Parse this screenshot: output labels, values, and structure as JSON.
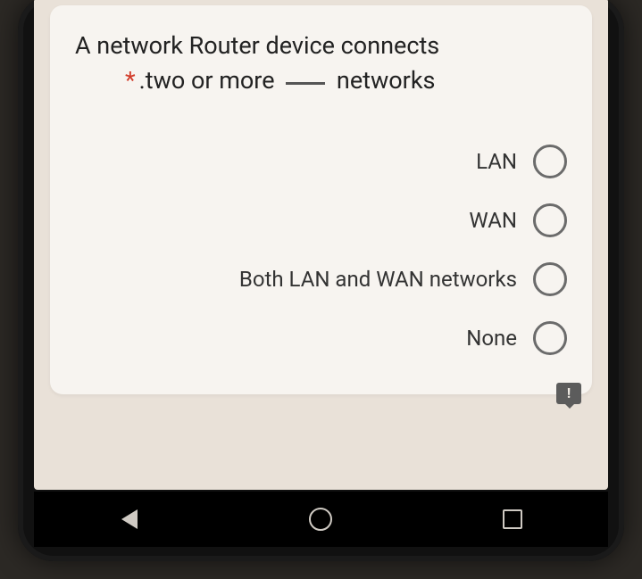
{
  "question": {
    "line1": "A network Router device connects",
    "required_mark": "*",
    "line2_pre": ".two or more",
    "line2_post": "networks"
  },
  "options": [
    {
      "label": "LAN"
    },
    {
      "label": "WAN"
    },
    {
      "label": "Both LAN and WAN networks"
    },
    {
      "label": "None"
    }
  ],
  "flag": {
    "glyph": "!"
  },
  "nav": {
    "back": "back-icon",
    "home": "home-icon",
    "recent": "recent-icon"
  }
}
